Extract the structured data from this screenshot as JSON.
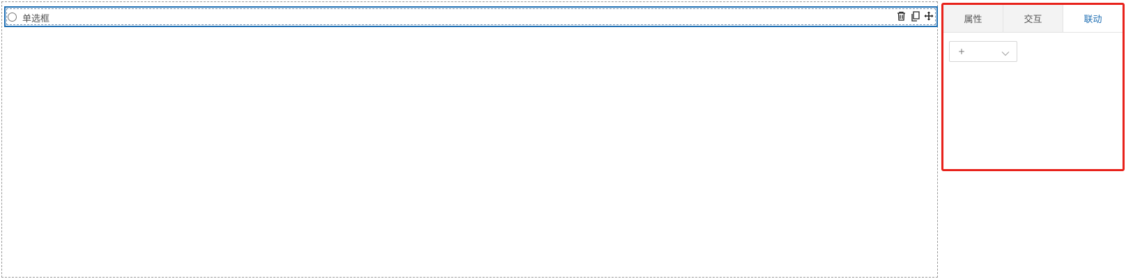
{
  "canvas": {
    "widget": {
      "label": "单选框",
      "icons": [
        "radio-circle-icon",
        "trash-icon",
        "copy-icon",
        "move-icon"
      ]
    }
  },
  "panel": {
    "tabs": [
      {
        "label": "属性",
        "active": false
      },
      {
        "label": "交互",
        "active": false
      },
      {
        "label": "联动",
        "active": true
      }
    ],
    "linkage_select": {
      "value": "+",
      "icon": "chevron-down-icon"
    }
  },
  "colors": {
    "accent": "#1f6fb3",
    "highlight_border": "#e8221b",
    "tab_inactive_bg": "#f3f3f3",
    "dashed_border": "#9a9a9a"
  }
}
